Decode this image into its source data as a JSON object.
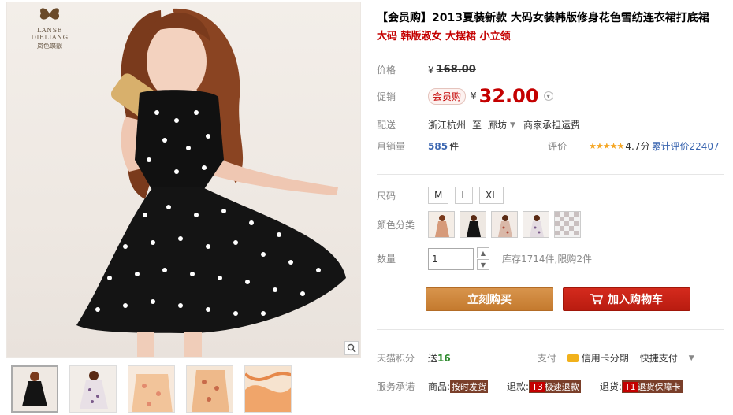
{
  "brand": {
    "name": "LANSE DIELIANG",
    "name_cn": "岚色蝶靓"
  },
  "product": {
    "title": "【会员购】2013夏装新款 大码女装韩版修身花色雪纺连衣裙打底裙",
    "subtitle": "大码 韩版淑女 大摆裙 小立领"
  },
  "price": {
    "label": "价格",
    "currency": "¥",
    "original": "168.00",
    "promo_label": "促销",
    "member_tag": "会员购",
    "promo_price": "32.00"
  },
  "shipping": {
    "label": "配送",
    "from": "浙江杭州",
    "to_word": "至",
    "to": "廊坊",
    "note": "商家承担运费"
  },
  "sales": {
    "label": "月销量",
    "count": "585",
    "unit": "件",
    "rating_label": "评价",
    "stars": "★★★★★",
    "score": "4.7分",
    "total_reviews": "累计评价22407"
  },
  "size": {
    "label": "尺码",
    "options": [
      "M",
      "L",
      "XL"
    ]
  },
  "color": {
    "label": "颜色分类"
  },
  "quantity": {
    "label": "数量",
    "value": "1",
    "stock": "库存1714件,限购2件"
  },
  "actions": {
    "buy_now": "立刻购买",
    "add_to_cart": "加入购物车"
  },
  "tmall_points": {
    "label": "天猫积分",
    "send": "送",
    "points": "16",
    "pay_label": "支付",
    "card_installment": "信用卡分期",
    "fast_pay": "快捷支付"
  },
  "service": {
    "label": "服务承诺",
    "goods": "商品:",
    "goods_tag": "按时发货",
    "refund": "退款:",
    "refund_code": "T3",
    "refund_tag": "极速退款",
    "return": "退货:",
    "return_code": "T1",
    "return_tag": "退货保障卡"
  },
  "colors": {
    "price_red": "#c40000",
    "buy_orange": "#c47a2e",
    "cart_red": "#b91c10",
    "link_blue": "#3c67b1",
    "star_gold": "#f5a623"
  },
  "icons": [
    "butterfly-logo-icon",
    "zoom-icon",
    "chevron-down-icon",
    "cart-icon",
    "credit-card-icon"
  ]
}
